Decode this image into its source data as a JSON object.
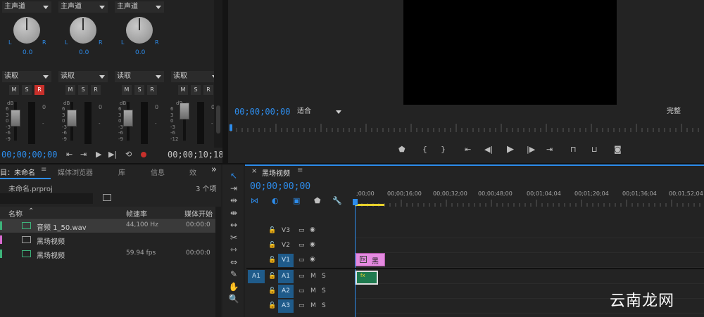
{
  "mixer": {
    "channels": [
      {
        "route": "主声道",
        "pan_value": "0.0",
        "mode": "读取",
        "m": "M",
        "s": "S",
        "r": "R",
        "r_active": true
      },
      {
        "route": "主声道",
        "pan_value": "0.0",
        "mode": "读取",
        "m": "M",
        "s": "S",
        "r": "R",
        "r_active": false
      },
      {
        "route": "主声道",
        "pan_value": "0.0",
        "mode": "读取",
        "m": "M",
        "s": "S",
        "r": "R",
        "r_active": false
      },
      {
        "route": "",
        "pan_value": "",
        "mode": "读取",
        "m": "M",
        "s": "S",
        "r": "R",
        "r_active": false
      }
    ],
    "pan_left": "L",
    "pan_right": "R",
    "db_label": "dB",
    "db_scale": [
      "6",
      "3",
      "0",
      "-3",
      "-6",
      "-9"
    ],
    "db_scale_last": [
      "6",
      "3",
      "0",
      "-3",
      "-6",
      "-12"
    ],
    "meter_top": "0",
    "meter_mid": "-",
    "timecode_current": "00;00;00;00",
    "timecode_duration": "00;00;10;18"
  },
  "program": {
    "timecode": "00;00;00;00",
    "fit_option": "适合",
    "quality_option": "完整"
  },
  "project": {
    "title": "目：未命名",
    "tabs": [
      "媒体浏览器",
      "库",
      "信息",
      "效"
    ],
    "overflow": "»",
    "menu": "≡",
    "file_name": "未命名.prproj",
    "item_count": "3 个项",
    "columns": {
      "name": "名称",
      "frame_rate": "帧速率",
      "media_start": "媒体开始"
    },
    "items": [
      {
        "name": "音频 1_50.wav",
        "frame_rate": "44,100 Hz",
        "media_start": "00:00:0",
        "color": "#3db37a",
        "icon": "audio-icon"
      },
      {
        "name": "黑场视频",
        "frame_rate": "",
        "media_start": "",
        "color": "#d86ad0",
        "icon": "sequence-icon"
      },
      {
        "name": "黑场视频",
        "frame_rate": "59.94 fps",
        "media_start": "00:00:0",
        "color": "#3db37a",
        "icon": "media-icon"
      }
    ]
  },
  "timeline": {
    "close": "×",
    "sequence_name": "黑场视频",
    "menu": "≡",
    "timecode": "00;00;00;00",
    "ruler": [
      ";00;00",
      "00;00;16;00",
      "00;00;32;00",
      "00;00;48;00",
      "00;01;04;04",
      "00;01;20;04",
      "00;01;36;04",
      "00;01;52;04"
    ],
    "source_patch": "A1",
    "tracks": [
      {
        "name": "V3",
        "selected": false,
        "type": "video"
      },
      {
        "name": "V2",
        "selected": false,
        "type": "video"
      },
      {
        "name": "V1",
        "selected": true,
        "type": "video"
      },
      {
        "name": "A1",
        "selected": true,
        "type": "audio"
      },
      {
        "name": "A2",
        "selected": true,
        "type": "audio"
      },
      {
        "name": "A3",
        "selected": true,
        "type": "audio"
      }
    ],
    "track_m": "M",
    "track_s": "S",
    "video_clip_label": "黑场",
    "audio_clip_label": "fx"
  },
  "watermark": "云南龙网",
  "colors": {
    "accent": "#2d8ceb",
    "video_clip": "#e48ae0",
    "audio_clip": "#1f7a4f",
    "record_red": "#c8302b"
  }
}
